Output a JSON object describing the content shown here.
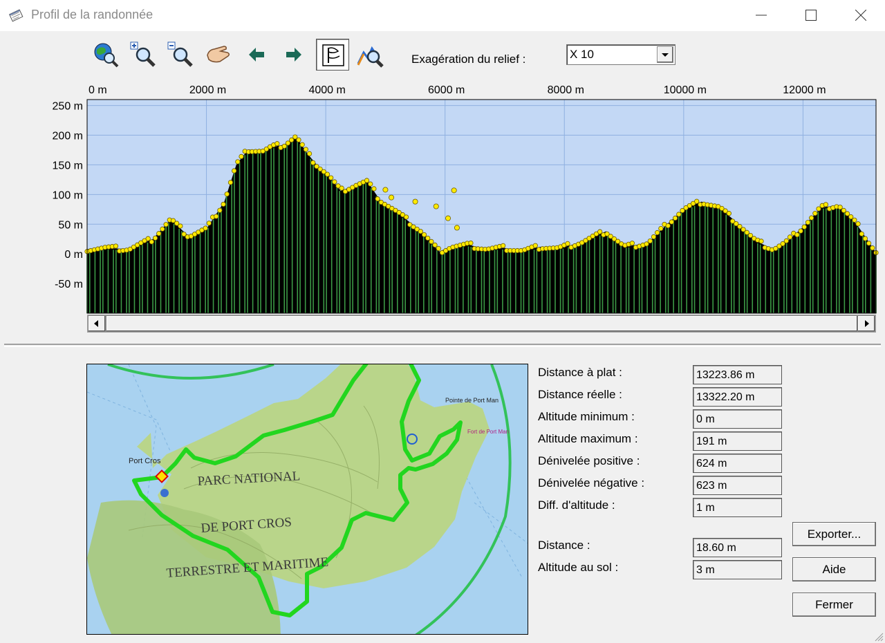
{
  "window": {
    "title": "Profil de la randonnée"
  },
  "toolbar": {
    "tools": [
      {
        "icon": "globe-search-icon"
      },
      {
        "icon": "zoom-in-icon"
      },
      {
        "icon": "zoom-out-icon"
      },
      {
        "icon": "hand-pan-icon"
      },
      {
        "icon": "arrow-left-icon"
      },
      {
        "icon": "arrow-right-icon"
      },
      {
        "icon": "flag-icon",
        "active": true
      },
      {
        "icon": "profile-search-icon"
      }
    ],
    "exaggeration_label": "Exagération du relief :",
    "exaggeration_value": "X 10"
  },
  "chart_data": {
    "type": "area",
    "x_unit": "m",
    "y_unit": "m",
    "xlim": [
      0,
      13223.86
    ],
    "ylim": [
      -100,
      260
    ],
    "x_ticks": [
      0,
      2000,
      4000,
      6000,
      8000,
      10000,
      12000
    ],
    "x_tick_labels": [
      "0 m",
      "2000 m",
      "4000 m",
      "6000 m",
      "8000 m",
      "10000 m",
      "12000 m"
    ],
    "y_ticks": [
      250,
      200,
      150,
      100,
      50,
      0,
      -50
    ],
    "y_tick_labels": [
      "250 m",
      "200 m",
      "150 m",
      "100 m",
      "50 m",
      "0 m",
      "-50 m"
    ],
    "grid": true,
    "colors": {
      "plot_bg": "#c3d8f5",
      "grid": "#8fb0e0",
      "fill": "#000000",
      "stripe": "#3c9a46",
      "point": "#ffea00"
    },
    "x": [
      0,
      300,
      700,
      1100,
      1400,
      1700,
      2000,
      2300,
      2500,
      2700,
      2950,
      3100,
      3300,
      3500,
      3700,
      3850,
      4050,
      4250,
      4500,
      4700,
      4900,
      5200,
      5600,
      5900,
      6100,
      6400,
      6700,
      7000,
      7300,
      7600,
      7900,
      8300,
      8700,
      9000,
      9400,
      9700,
      10000,
      10300,
      10600,
      10900,
      11200,
      11500,
      11700,
      12000,
      12300,
      12600,
      12900,
      13223.86
    ],
    "y": [
      8,
      10,
      8,
      25,
      58,
      30,
      42,
      88,
      150,
      176,
      173,
      180,
      184,
      198,
      168,
      150,
      132,
      106,
      116,
      122,
      92,
      70,
      38,
      4,
      12,
      15,
      8,
      10,
      5,
      12,
      9,
      20,
      38,
      12,
      18,
      48,
      75,
      88,
      78,
      52,
      22,
      8,
      18,
      45,
      78,
      82,
      50,
      2
    ],
    "outliers": [
      {
        "x": 5100,
        "y": 95
      },
      {
        "x": 5500,
        "y": 88
      },
      {
        "x": 5850,
        "y": 80
      },
      {
        "x": 6050,
        "y": 60
      },
      {
        "x": 6150,
        "y": 107
      },
      {
        "x": 6200,
        "y": 44
      },
      {
        "x": 5000,
        "y": 108
      }
    ]
  },
  "stats": [
    {
      "label": "Distance à plat :",
      "value": "13223.86 m"
    },
    {
      "label": "Distance réelle :",
      "value": "13322.20 m"
    },
    {
      "label": "Altitude minimum :",
      "value": "0 m"
    },
    {
      "label": "Altitude maximum :",
      "value": "191 m"
    },
    {
      "label": "Dénivelée positive :",
      "value": "624 m"
    },
    {
      "label": "Dénivelée négative :",
      "value": "623 m"
    },
    {
      "label": "Diff. d'altitude :",
      "value": "1 m"
    },
    {
      "label": "Distance :",
      "value": "18.60 m"
    },
    {
      "label": "Altitude au sol :",
      "value": "3 m"
    }
  ],
  "buttons": {
    "export": "Exporter...",
    "help": "Aide",
    "close": "Fermer"
  },
  "map": {
    "labels": [
      {
        "text": "PARC  NATIONAL"
      },
      {
        "text": "DE  PORT  CROS"
      },
      {
        "text": "TERRESTRE  ET  MARITIME"
      },
      {
        "text": "Port Cros"
      },
      {
        "text": "Pointe de Port Man"
      },
      {
        "text": "Fort de Port Man"
      }
    ],
    "colors": {
      "sea": "#a9d2f0",
      "land": "#b9d58a",
      "route": "#22d61f"
    }
  }
}
